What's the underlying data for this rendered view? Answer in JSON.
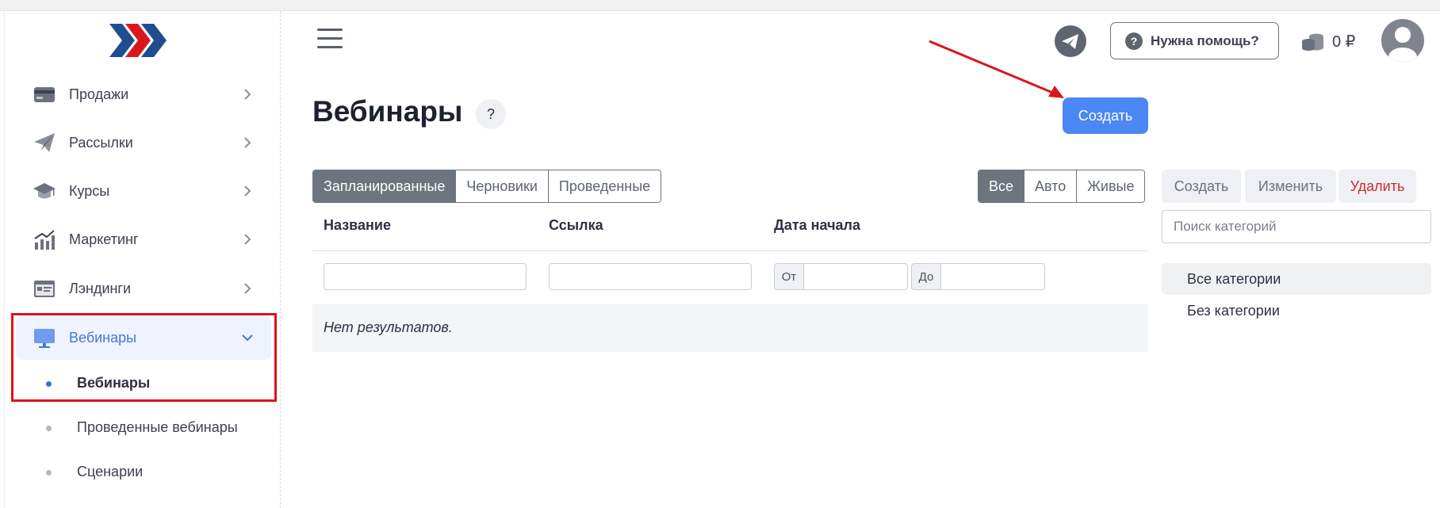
{
  "sidebar": {
    "items": [
      {
        "label": "Продажи",
        "icon": "credit-card-icon"
      },
      {
        "label": "Рассылки",
        "icon": "paper-plane-icon"
      },
      {
        "label": "Курсы",
        "icon": "graduation-cap-icon"
      },
      {
        "label": "Маркетинг",
        "icon": "chart-growth-icon"
      },
      {
        "label": "Лэндинги",
        "icon": "landing-page-icon"
      },
      {
        "label": "Вебинары",
        "icon": "monitor-icon"
      }
    ],
    "subitems": [
      {
        "label": "Вебинары"
      },
      {
        "label": "Проведенные вебинары"
      },
      {
        "label": "Сценарии"
      }
    ]
  },
  "header": {
    "help_label": "Нужна помощь?",
    "balance": "0 ₽"
  },
  "page": {
    "title": "Вебинары",
    "title_help": "?",
    "create_label": "Создать"
  },
  "status_tabs": [
    "Запланированные",
    "Черновики",
    "Проведенные"
  ],
  "type_tabs": [
    "Все",
    "Авто",
    "Живые"
  ],
  "table": {
    "columns": [
      "Название",
      "Ссылка",
      "Дата начала"
    ],
    "date_from": "От",
    "date_to": "До",
    "empty_text": "Нет результатов."
  },
  "categories": {
    "create": "Создать",
    "edit": "Изменить",
    "delete": "Удалить",
    "search_placeholder": "Поиск категорий",
    "items": [
      "Все категории",
      "Без категории"
    ]
  },
  "colors": {
    "primary": "#4c87f6",
    "active_nav_bg": "#eef3ff",
    "annotation_red": "#d9151d"
  }
}
